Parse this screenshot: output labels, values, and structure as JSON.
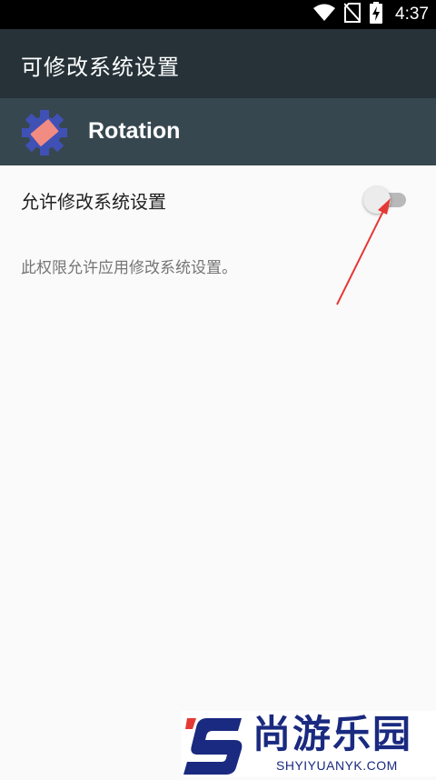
{
  "status_bar": {
    "time": "4:37",
    "icons": [
      "wifi-icon",
      "no-sim-icon",
      "battery-charging-icon"
    ]
  },
  "app_bar": {
    "title": "可修改系统设置"
  },
  "app_header": {
    "app_name": "Rotation",
    "icon": "rotation-app-icon"
  },
  "setting": {
    "label": "允许修改系统设置",
    "enabled": false,
    "description": "此权限允许应用修改系统设置。"
  },
  "annotation": {
    "color": "#e53935"
  },
  "watermark": {
    "chars": "尚游乐园",
    "url": "SHYIYUANYK.COM"
  },
  "colors": {
    "app_bar": "#263238",
    "app_header": "#37474f",
    "background": "#fafafa",
    "watermark_blue": "#1a2a80"
  }
}
